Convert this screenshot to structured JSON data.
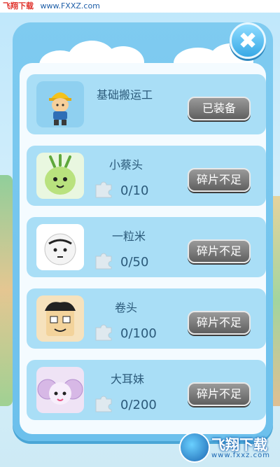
{
  "watermark": {
    "brand": "飞翔下载",
    "url": "www.FXXZ.com"
  },
  "close_glyph": "✖",
  "characters": [
    {
      "name": "基础搬运工",
      "button": "已装备",
      "progress": null
    },
    {
      "name": "小蔡头",
      "button": "碎片不足",
      "progress": "0/10"
    },
    {
      "name": "一粒米",
      "button": "碎片不足",
      "progress": "0/50"
    },
    {
      "name": "卷头",
      "button": "碎片不足",
      "progress": "0/100"
    },
    {
      "name": "大耳妹",
      "button": "碎片不足",
      "progress": "0/200"
    }
  ],
  "logo": {
    "title": "飞翔下载",
    "url": "www.fxxz.com"
  },
  "colors": {
    "panel": "#7fcbf0",
    "card": "#a9def6",
    "button_gray": "#7a7a7a",
    "text": "#2b5a7a"
  }
}
